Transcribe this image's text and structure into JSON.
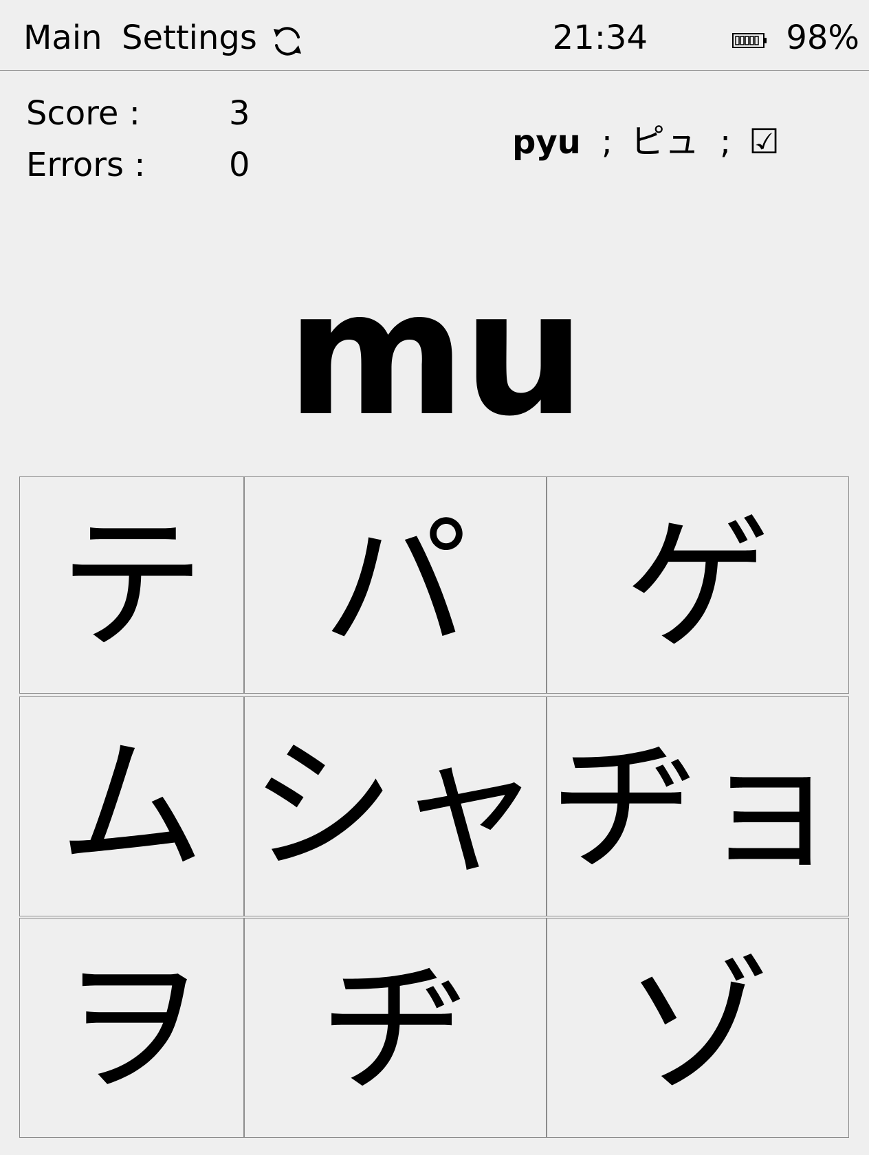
{
  "menu": {
    "main": "Main",
    "settings": "Settings",
    "refresh_icon": "refresh-icon"
  },
  "status": {
    "time": "21:34",
    "battery_icon": "battery-icon",
    "battery_level": 0.98,
    "battery_percent": "98%"
  },
  "stats": {
    "score_label": "Score :",
    "score_value": "3",
    "errors_label": "Errors :",
    "errors_value": "0"
  },
  "last_answer": {
    "romaji": "pyu",
    "separator": ";",
    "kana": "ピュ",
    "result": "☑"
  },
  "prompt": "mu",
  "choices": [
    [
      "テ",
      "パ",
      "ゲ"
    ],
    [
      "ム",
      "シャ",
      "ヂョ"
    ],
    [
      "ヲ",
      "ヂ",
      "ゾ"
    ]
  ]
}
